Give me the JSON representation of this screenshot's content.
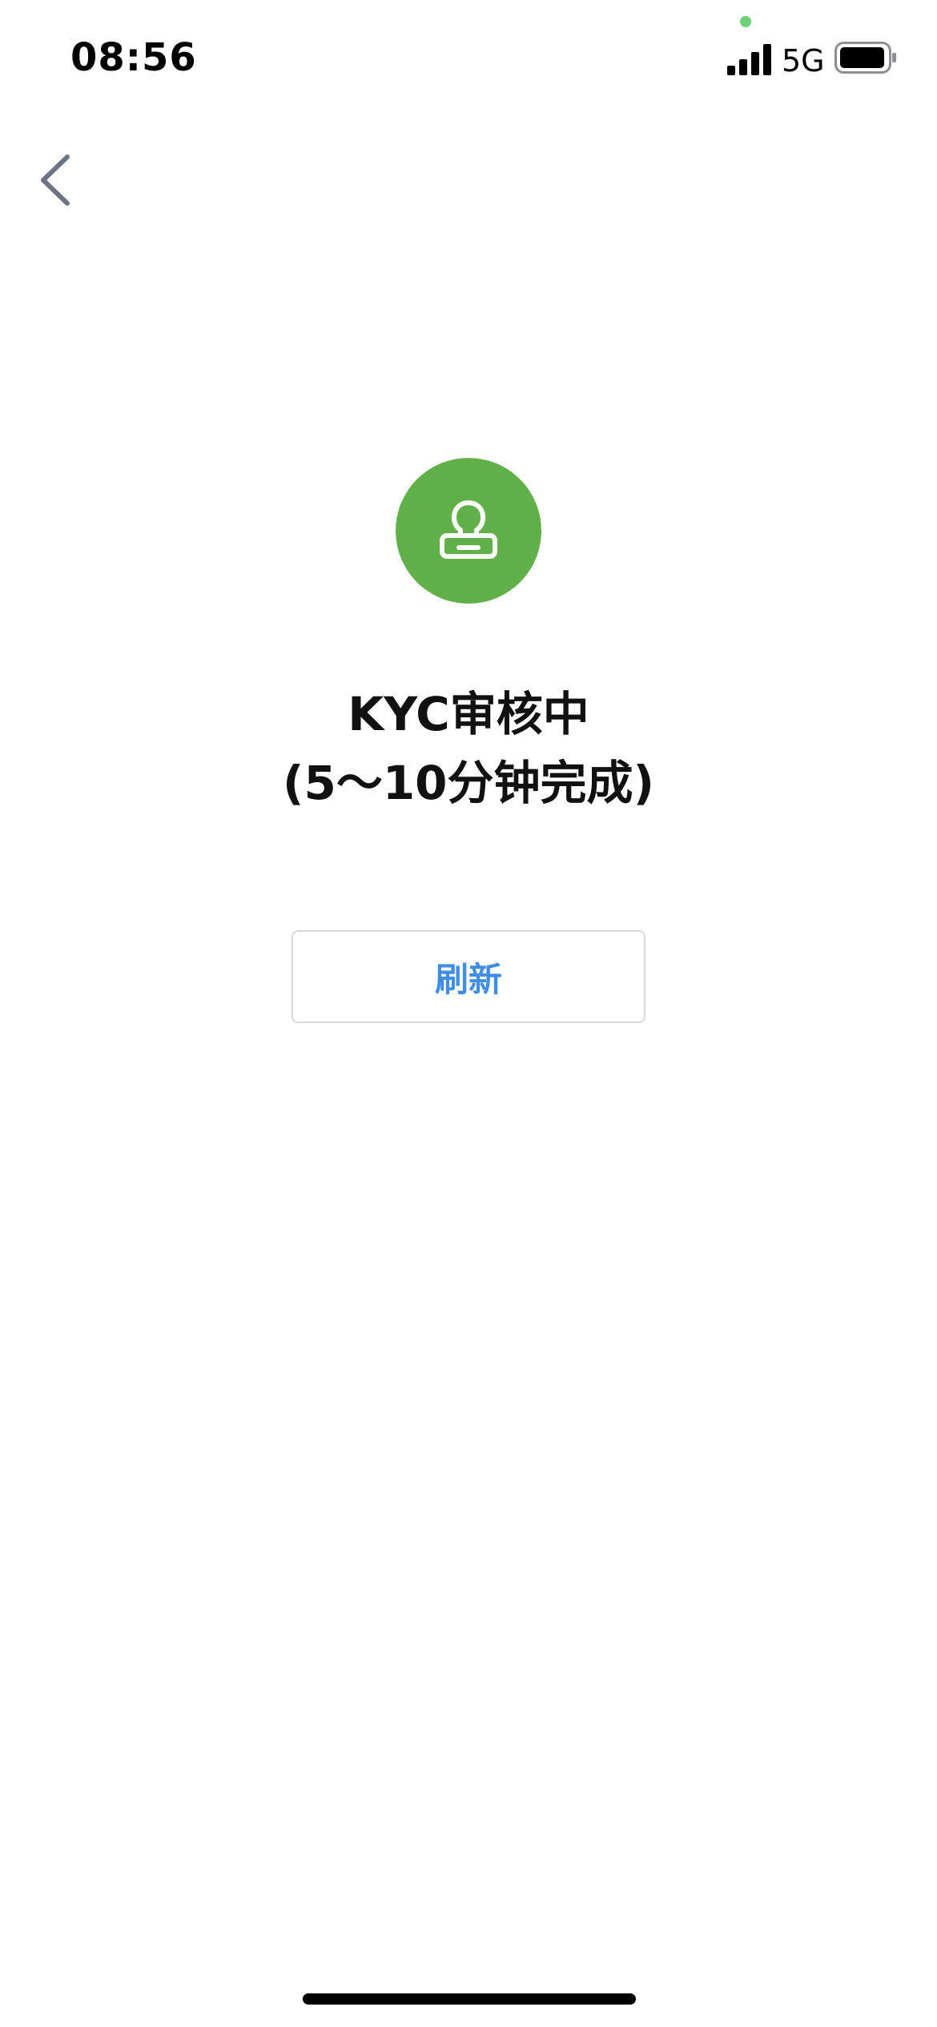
{
  "status_bar": {
    "time": "08:56",
    "network": "5G",
    "signal_icon": "signal-bars-icon",
    "battery_icon": "battery-icon"
  },
  "nav": {
    "back_icon": "chevron-left-icon"
  },
  "status": {
    "icon": "stamp-icon",
    "title": "KYC审核中",
    "subtitle": "(5～10分钟完成)"
  },
  "actions": {
    "refresh_label": "刷新"
  },
  "colors": {
    "accent": "#3f8ee4",
    "status_green": "#62b049",
    "back_icon": "#6b7385",
    "button_border": "#d9d9d9"
  }
}
